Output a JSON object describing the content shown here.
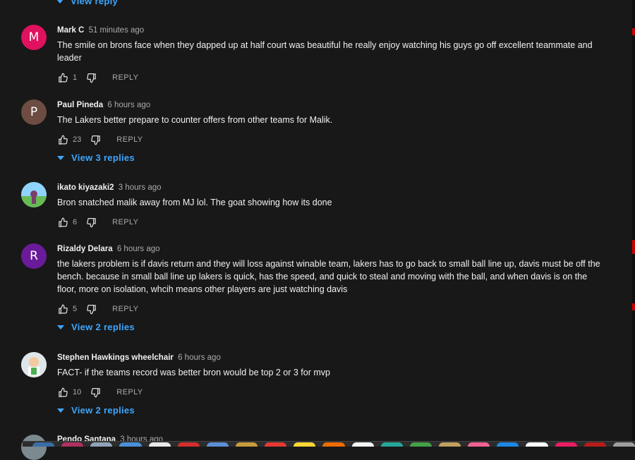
{
  "top_view_reply": "View reply",
  "comments": [
    {
      "author": "Mark C",
      "time": "51 minutes ago",
      "avatar_letter": "M",
      "avatar_color": "#e0115f",
      "text": "The smile on brons face when they dapped up at half court was beautiful he really enjoy watching his guys go off excellent teammate and leader",
      "likes": "1",
      "reply_label": "REPLY",
      "view_replies": ""
    },
    {
      "author": "Paul Pineda",
      "time": "6 hours ago",
      "avatar_letter": "P",
      "avatar_color": "#6d4c41",
      "text": "The Lakers better prepare to counter offers from other teams for Malik.",
      "likes": "23",
      "reply_label": "REPLY",
      "view_replies": "View 3 replies"
    },
    {
      "author": "ikato kiyazaki2",
      "time": "3 hours ago",
      "avatar_letter": "",
      "avatar_color": "#7fbf6a",
      "text": "Bron snatched malik away from MJ lol. The goat showing how its done",
      "likes": "6",
      "reply_label": "REPLY",
      "view_replies": ""
    },
    {
      "author": "Rizaldy Delara",
      "time": "6 hours ago",
      "avatar_letter": "R",
      "avatar_color": "#6a1b9a",
      "text": "the lakers problem is if davis return and they will loss against winable team, lakers has to go back to small ball line up, davis must be off the bench. because in small ball line up lakers is quick, has the speed, and quick to steal and moving with the ball,  and when davis is on the floor, more on isolation, whcih means other players are just watching davis",
      "likes": "5",
      "reply_label": "REPLY",
      "view_replies": "View 2 replies"
    },
    {
      "author": "Stephen Hawkings wheelchair",
      "time": "6 hours ago",
      "avatar_letter": "",
      "avatar_color": "#cfd8dc",
      "text": "FACT- if the teams record was better bron would be top 2 or 3 for mvp",
      "likes": "10",
      "reply_label": "REPLY",
      "view_replies": "View 2 replies"
    }
  ],
  "partial_comment": {
    "author": "Pendo Santana",
    "time": "3 hours ago"
  },
  "colors": {
    "background": "#181818",
    "link_blue": "#3ea6ff",
    "secondary_text": "#aaaaaa"
  }
}
